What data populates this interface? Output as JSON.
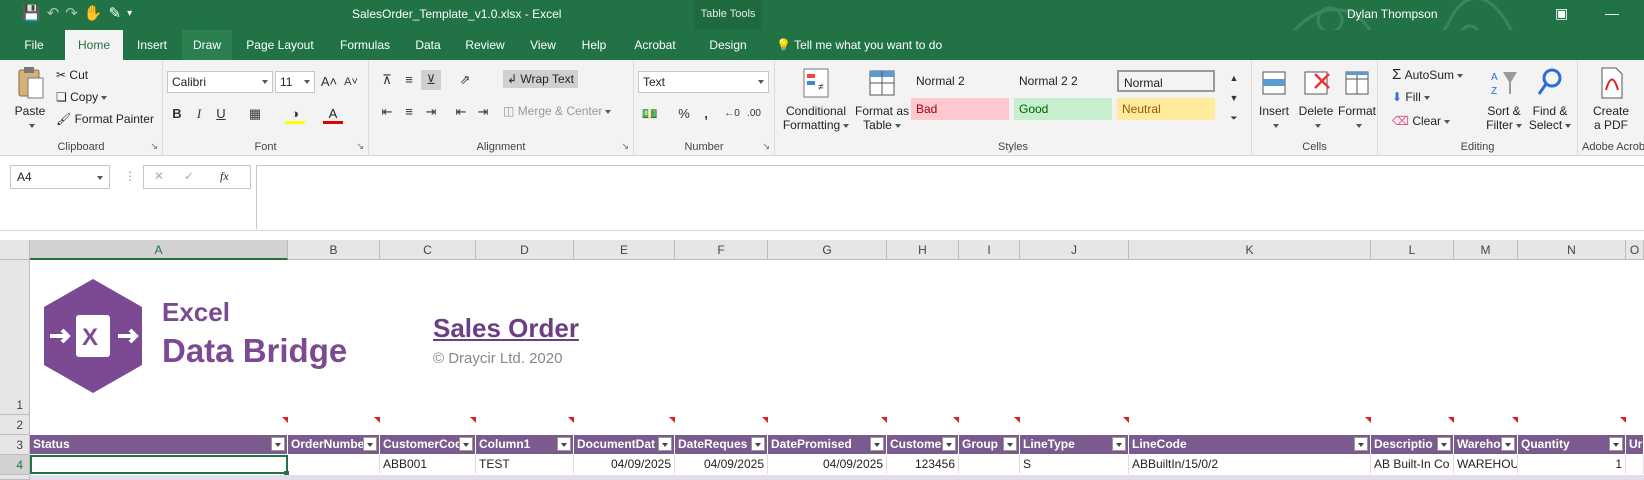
{
  "titlebar": {
    "filename": "SalesOrder_Template_v1.0.xlsx  -  Excel",
    "context_label": "Table Tools",
    "user": "Dylan Thompson"
  },
  "tabs": [
    "File",
    "Home",
    "Insert",
    "Draw",
    "Page Layout",
    "Formulas",
    "Data",
    "Review",
    "View",
    "Help",
    "Acrobat",
    "Design"
  ],
  "tell_me": "Tell me what you want to do",
  "ribbon": {
    "clipboard": {
      "paste": "Paste",
      "cut": "Cut",
      "copy": "Copy",
      "format_painter": "Format Painter",
      "label": "Clipboard"
    },
    "font": {
      "name": "Calibri",
      "size": "11",
      "label": "Font",
      "bold": "B",
      "italic": "I",
      "underline": "U"
    },
    "alignment": {
      "wrap": "Wrap Text",
      "merge": "Merge & Center",
      "label": "Alignment"
    },
    "number": {
      "format": "Text",
      "label": "Number",
      "percent": "%",
      "comma": ","
    },
    "styles": {
      "conditional": [
        "Conditional",
        "Formatting"
      ],
      "format_table": [
        "Format as",
        "Table"
      ],
      "cells": [
        {
          "name": "Normal 2",
          "bg": "#ffffff",
          "color": "#222222"
        },
        {
          "name": "Normal 2 2",
          "bg": "#ffffff",
          "color": "#222222"
        },
        {
          "name": "Normal",
          "bg": "#ffffff",
          "color": "#222222"
        },
        {
          "name": "Bad",
          "bg": "#ffc7ce",
          "color": "#9c0006"
        },
        {
          "name": "Good",
          "bg": "#c6efce",
          "color": "#006100"
        },
        {
          "name": "Neutral",
          "bg": "#ffeb9c",
          "color": "#9c5700"
        }
      ],
      "label": "Styles"
    },
    "cells_group": {
      "insert": "Insert",
      "delete": "Delete",
      "format": "Format",
      "label": "Cells"
    },
    "editing": {
      "autosum": "AutoSum",
      "fill": "Fill",
      "clear": "Clear",
      "sort": [
        "Sort &",
        "Filter"
      ],
      "find": [
        "Find &",
        "Select"
      ],
      "label": "Editing"
    },
    "adobe": {
      "create": [
        "Create",
        "a PDF"
      ],
      "label": "Adobe Acrob"
    }
  },
  "formula_bar": {
    "name_box": "A4",
    "formula": ""
  },
  "columns": [
    "A",
    "B",
    "C",
    "D",
    "E",
    "F",
    "G",
    "H",
    "I",
    "J",
    "K",
    "L",
    "M",
    "N",
    "O"
  ],
  "rows": [
    "1",
    "2",
    "3",
    "4"
  ],
  "banner": {
    "logo_line1": "Excel",
    "logo_line2": "Data Bridge",
    "title": "Sales Order",
    "copyright": "© Draycir Ltd. 2020"
  },
  "table": {
    "headers": [
      "Status",
      "OrderNumbe",
      "CustomerCod",
      "Column1",
      "DocumentDat",
      "DateReques",
      "DatePromised",
      "Custome",
      "Group",
      "LineType",
      "LineCode",
      "Descriptio",
      "Wareho",
      "Quantity",
      "Ur"
    ],
    "row": [
      "",
      "",
      "ABB001",
      "TEST",
      "04/09/2025",
      "04/09/2025",
      "04/09/2025",
      "123456",
      "",
      "S",
      "ABBuiltIn/15/0/2",
      "AB Built-In Co",
      "WAREHOU",
      "1",
      ""
    ]
  },
  "colors": {
    "accent": "#217346",
    "header_purple": "#7b5a8e",
    "logo_purple": "#7b4a92"
  }
}
